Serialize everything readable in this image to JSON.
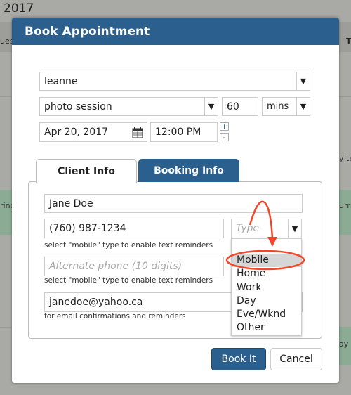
{
  "background": {
    "year": "2017",
    "fragments": [
      "ues",
      "T",
      "ring",
      "urri",
      "y te",
      "ay"
    ]
  },
  "dialog": {
    "title": "Book Appointment"
  },
  "form": {
    "staff": "leanne",
    "service": "photo session",
    "duration": "60",
    "duration_unit": "mins",
    "date": "Apr 20, 2017",
    "time": "12:00 PM",
    "time_increment": "+",
    "time_decrement": "-"
  },
  "tabs": [
    {
      "label": "Client Info",
      "active": true
    },
    {
      "label": "Booking Info",
      "active": false
    }
  ],
  "client": {
    "name": "Jane Doe",
    "phone": "(760) 987-1234",
    "phone_type_placeholder": "Type",
    "phone_hint": "select \"mobile\" type to enable text reminders",
    "alt_phone_placeholder": "Alternate phone (10 digits)",
    "alt_phone_hint": "select \"mobile\" type to enable text reminders",
    "email": "janedoe@yahoo.ca",
    "email_hint": "for email confirmations and reminders"
  },
  "phone_type_options": [
    "Mobile",
    "Home",
    "Work",
    "Day",
    "Eve/Wknd",
    "Other"
  ],
  "highlighted_option": "Mobile",
  "annotation_color": "#f0472a",
  "accent": "#2b5f8e",
  "buttons": {
    "book": "Book It",
    "cancel": "Cancel"
  }
}
